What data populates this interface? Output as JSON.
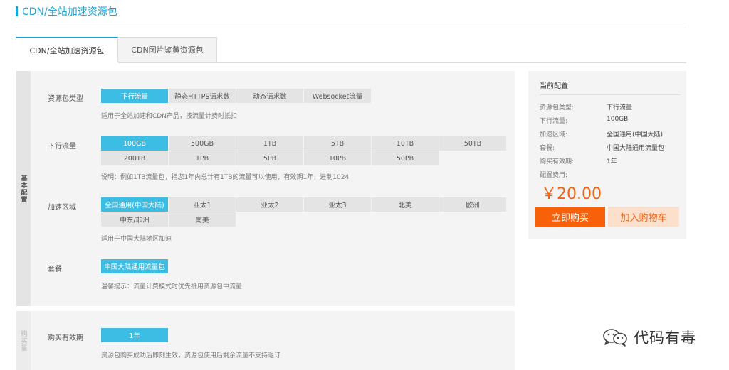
{
  "page": {
    "title": "CDN/全站加速资源包"
  },
  "tabs": [
    {
      "label": "CDN/全站加速资源包",
      "active": true
    },
    {
      "label": "CDN图片鉴黄资源包",
      "active": false
    }
  ],
  "sections": {
    "basic": {
      "label": "基本配置"
    },
    "buy": {
      "label": "购买量"
    }
  },
  "package_type": {
    "label": "资源包类型",
    "options": [
      "下行流量",
      "静态HTTPS请求数",
      "动态请求数",
      "Websocket流量"
    ],
    "selected": 0,
    "hint": "适用于全站加速和CDN产品，按流量计费时抵扣"
  },
  "traffic": {
    "label": "下行流量",
    "options": [
      "100GB",
      "500GB",
      "1TB",
      "5TB",
      "10TB",
      "50TB",
      "200TB",
      "1PB",
      "5PB",
      "10PB",
      "50PB"
    ],
    "selected": 0,
    "hint": "说明：例如1TB流量包，指您1年内总计有1TB的流量可以使用，有效期1年，进制1024"
  },
  "region": {
    "label": "加速区域",
    "options": [
      "全国通用(中国大陆)",
      "亚太1",
      "亚太2",
      "亚太3",
      "北美",
      "欧洲",
      "中东/非洲",
      "南美"
    ],
    "selected": 0,
    "hint": "适用于中国大陆地区加速"
  },
  "plan": {
    "label": "套餐",
    "options": [
      "中国大陆通用流量包"
    ],
    "selected": 0,
    "hint": "温馨提示：流量计费模式时优先抵用资源包中流量"
  },
  "validity": {
    "label": "购买有效期",
    "options": [
      "1年"
    ],
    "selected": 0,
    "hint": "资源包购买成功后即刻生效，资源包使用后剩余流量不支持退订"
  },
  "config": {
    "title": "当前配置",
    "rows": [
      {
        "k": "资源包类型:",
        "v": "下行流量"
      },
      {
        "k": "下行流量:",
        "v": "100GB"
      },
      {
        "k": "加速区域:",
        "v": "全国通用(中国大陆)"
      },
      {
        "k": "套餐:",
        "v": "中国大陆通用流量包"
      },
      {
        "k": "购买有效期:",
        "v": "1年"
      },
      {
        "k": "配置费用:",
        "v": ""
      }
    ],
    "price": "￥20.00",
    "buy_label": "立即购买",
    "cart_label": "加入购物车"
  },
  "watermark": {
    "text": "代码有毒",
    "icon": "wechat-icon"
  },
  "colors": {
    "accent": "#1aa3d7",
    "selected": "#3cbde4",
    "buy": "#f8600a",
    "price": "#f06418"
  }
}
